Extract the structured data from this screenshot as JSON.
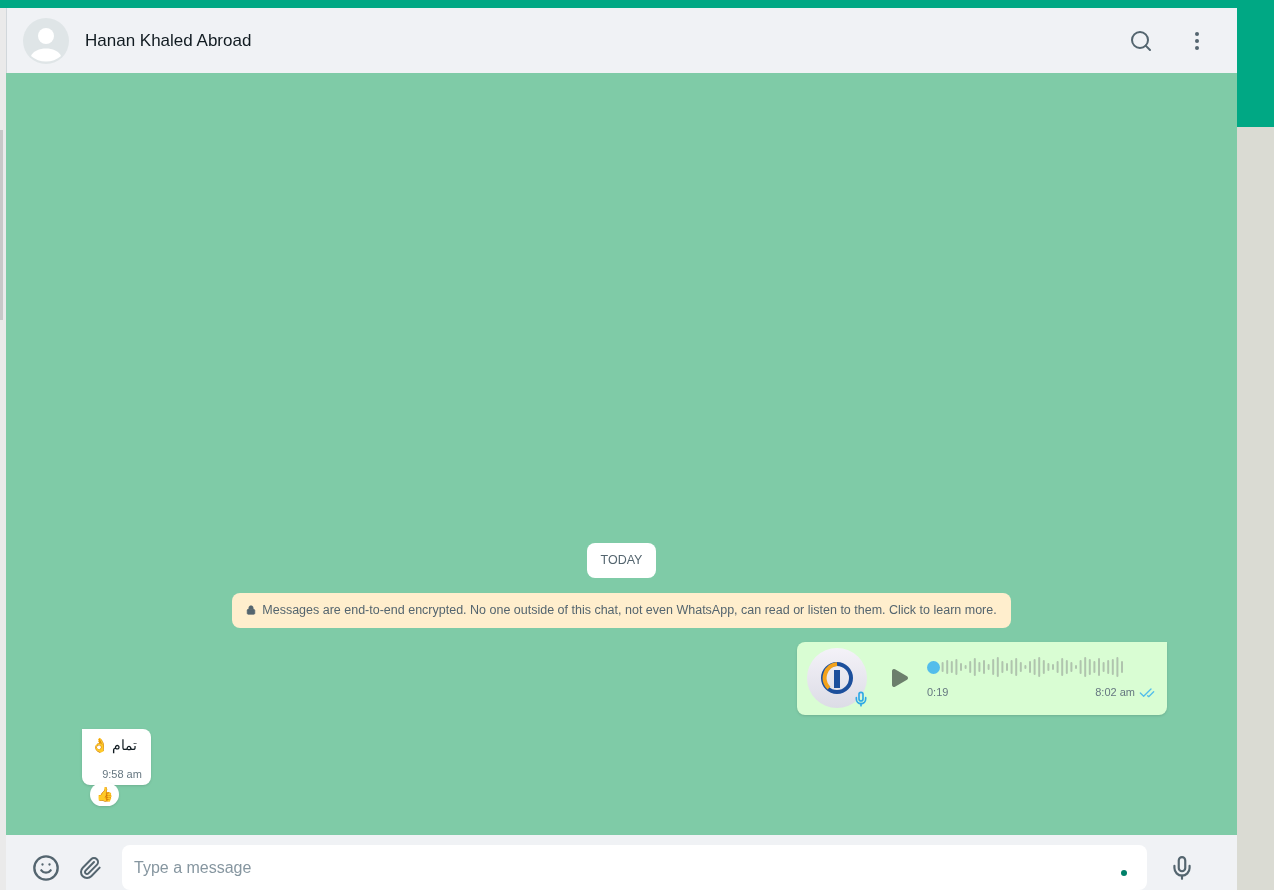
{
  "chat": {
    "name": "Hanan Khaled Abroad"
  },
  "date_divider": "TODAY",
  "notice": "Messages are end-to-end encrypted. No one outside of this chat, not even WhatsApp, can read or listen to them. Click to learn more.",
  "messages": [
    {
      "kind": "voice",
      "outgoing": true,
      "duration": "0:19",
      "time": "8:02 am",
      "read": true,
      "level": 0
    },
    {
      "kind": "text",
      "outgoing": false,
      "text": "تمام 👌",
      "time": "9:58 am",
      "reaction": "👍"
    }
  ],
  "composer": {
    "placeholder": "Type a message"
  }
}
